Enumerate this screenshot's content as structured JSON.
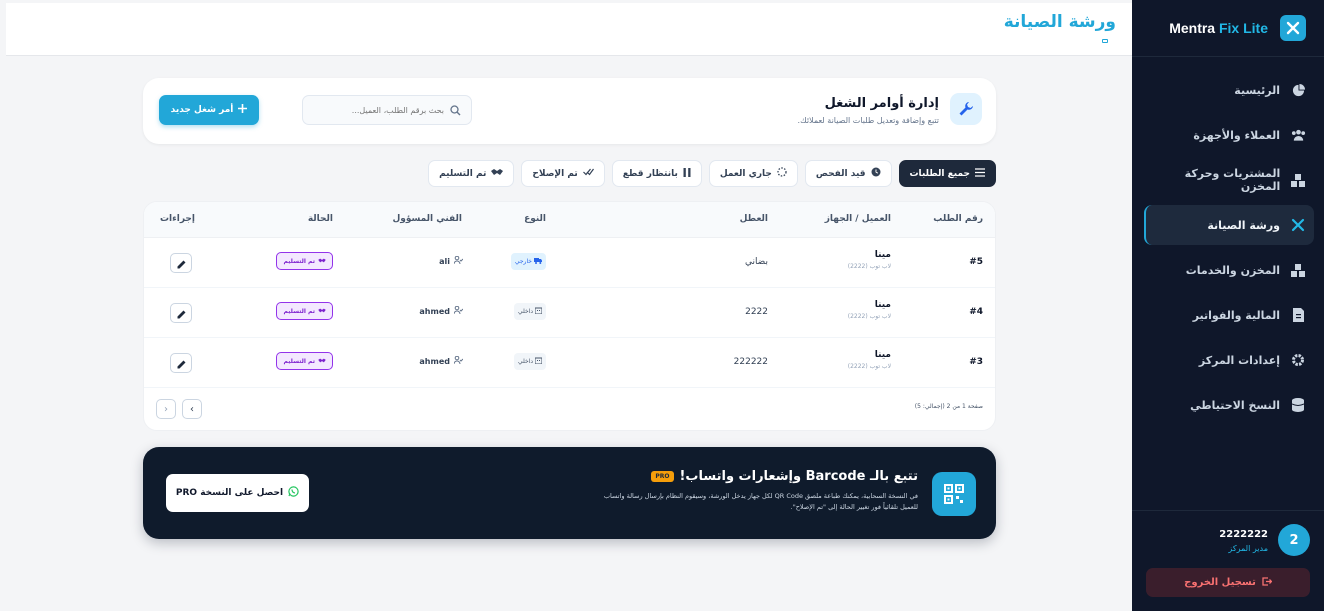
{
  "brand": {
    "name_main": "Mentra",
    "name_accent": "Fix Lite"
  },
  "sidebar": {
    "items": [
      {
        "label": "الرئيسية",
        "icon": "pie-chart-icon"
      },
      {
        "label": "العملاء والأجهزة",
        "icon": "users-icon"
      },
      {
        "label": "المشتريات وحركة المخزن",
        "icon": "boxes-icon"
      },
      {
        "label": "ورشة الصيانة",
        "icon": "tools-icon",
        "active": true
      },
      {
        "label": "المخزن والخدمات",
        "icon": "warehouse-icon"
      },
      {
        "label": "المالية والفواتير",
        "icon": "invoice-icon"
      },
      {
        "label": "إعدادات المركز",
        "icon": "gear-icon"
      },
      {
        "label": "النسخ الاحتياطي",
        "icon": "database-icon"
      }
    ],
    "user": {
      "avatar": "2",
      "name": "2222222",
      "role": "مدير المركز"
    },
    "logout_label": "تسجيل الخروج"
  },
  "header": {
    "title": "ورشة الصيانة"
  },
  "work_orders": {
    "title": "إدارة أوامر الشغل",
    "subtitle": "تتبع وإضافة وتعديل طلبات الصيانة لعملائك.",
    "search_placeholder": "بحث برقم الطلب، العميل...",
    "new_button": "أمر شغل جديد"
  },
  "filters": [
    {
      "label": "جميع الطلبات",
      "icon": "list-icon",
      "active": true
    },
    {
      "label": "قيد الفحص",
      "icon": "clock-icon"
    },
    {
      "label": "جاري العمل",
      "icon": "spinner-icon"
    },
    {
      "label": "بانتظار قطع",
      "icon": "pause-icon"
    },
    {
      "label": "تم الإصلاح",
      "icon": "double-check-icon"
    },
    {
      "label": "تم التسليم",
      "icon": "handshake-icon"
    }
  ],
  "table": {
    "columns": [
      "رقم الطلب",
      "العميل / الجهاز",
      "العطل",
      "النوع",
      "الفني المسؤول",
      "الحالة",
      "إجراءات"
    ],
    "rows": [
      {
        "id": "#5",
        "client": "مينا",
        "device": "لاب توب (2222)",
        "fault": "بضاني",
        "type": "خارجي",
        "type_kind": "external",
        "tech": "ali",
        "status": "تم التسليم"
      },
      {
        "id": "#4",
        "client": "مينا",
        "device": "لاب توب (2222)",
        "fault": "2222",
        "type": "داخلي",
        "type_kind": "internal",
        "tech": "ahmed",
        "status": "تم التسليم"
      },
      {
        "id": "#3",
        "client": "مينا",
        "device": "لاب توب (2222)",
        "fault": "222222",
        "type": "داخلي",
        "type_kind": "internal",
        "tech": "ahmed",
        "status": "تم التسليم"
      }
    ],
    "pagination": "صفحة 1 من 2 (إجمالي: 5)"
  },
  "promo": {
    "title": "تتبع بالـ Barcode وإشعارات واتساب!",
    "badge": "PRO",
    "description": "في النسخة السحابية، يمكنك طباعة ملصق QR Code لكل جهاز يدخل الورشة، وسيقوم النظام بإرسال رسالة واتساب للعميل تلقائياً فور تغيير الحالة إلى \"تم الإصلاح\".",
    "button": "احصل على النسخة PRO"
  }
}
